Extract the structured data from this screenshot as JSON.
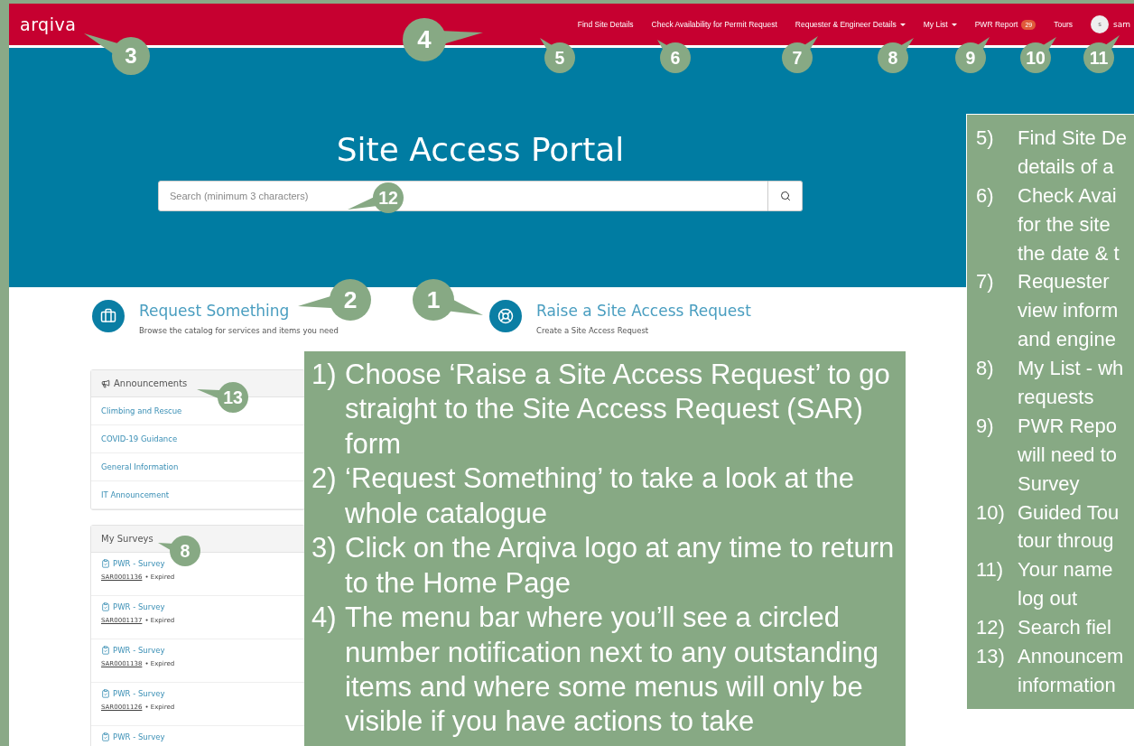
{
  "header": {
    "logo": "arqiva",
    "nav": [
      {
        "label": "Find Site Details",
        "has_menu": false
      },
      {
        "label": "Check Availability for Permit Request",
        "has_menu": false
      },
      {
        "label": "Requester & Engineer Details",
        "has_menu": true
      },
      {
        "label": "My List",
        "has_menu": true
      },
      {
        "label": "PWR Report",
        "has_menu": false,
        "badge": "29"
      },
      {
        "label": "Tours",
        "has_menu": false
      }
    ],
    "user": {
      "initial": "s",
      "name": "sam"
    }
  },
  "hero": {
    "title": "Site Access Portal",
    "search": {
      "placeholder": "Search (minimum 3 characters)"
    }
  },
  "actions": [
    {
      "title": "Request Something",
      "subtitle": "Browse the catalog for services and items you need"
    },
    {
      "title": "Raise a Site Access Request",
      "subtitle": "Create a Site Access Request"
    }
  ],
  "announcements": {
    "title": "Announcements",
    "items": [
      "Climbing and Rescue",
      "COVID-19 Guidance",
      "General Information",
      "IT Announcement"
    ]
  },
  "surveys": {
    "title": "My Surveys",
    "items": [
      {
        "name": "PWR - Survey",
        "number": "SAR0001136",
        "status": "• Expired"
      },
      {
        "name": "PWR - Survey",
        "number": "SAR0001137",
        "status": "• Expired"
      },
      {
        "name": "PWR - Survey",
        "number": "SAR0001138",
        "status": "• Expired"
      },
      {
        "name": "PWR - Survey",
        "number": "SAR0001126",
        "status": "• Expired"
      },
      {
        "name": "PWR - Survey"
      }
    ]
  },
  "callouts": [
    "3",
    "4",
    "5",
    "6",
    "7",
    "8",
    "9",
    "10",
    "11",
    "12",
    "2",
    "1",
    "13",
    "8"
  ],
  "notes_main": [
    {
      "number": "1)",
      "text": "Choose ‘Raise a Site Access Request’ to go straight to the Site Access Request (SAR) form"
    },
    {
      "number": "2)",
      "text": "‘Request Something’ to take a look at the whole catalogue"
    },
    {
      "number": "3)",
      "text": "Click on the Arqiva logo at any time to return to the Home Page"
    },
    {
      "number": "4)",
      "text": "The menu bar where you’ll see a circled number notification next to any outstanding items and where some menus will only be visible if you have actions to take"
    }
  ],
  "notes_side": [
    {
      "number": "5)",
      "lines": [
        "Find Site De",
        "details of a"
      ]
    },
    {
      "number": "6)",
      "lines": [
        "Check Avai",
        "for the site",
        "the date & t"
      ]
    },
    {
      "number": "7)",
      "lines": [
        "Requester",
        "view inform",
        "and engine"
      ]
    },
    {
      "number": "8)",
      "lines": [
        "My List - wh",
        "requests"
      ]
    },
    {
      "number": "9)",
      "lines": [
        "PWR Repo",
        "will need to",
        "Survey"
      ]
    },
    {
      "number": "10)",
      "lines": [
        "Guided Tou",
        "tour throug"
      ]
    },
    {
      "number": "11)",
      "lines": [
        "Your name",
        "log out"
      ]
    },
    {
      "number": "12)",
      "lines": [
        "Search fiel"
      ]
    },
    {
      "number": "13)",
      "lines": [
        "Announcem",
        "information"
      ]
    }
  ]
}
